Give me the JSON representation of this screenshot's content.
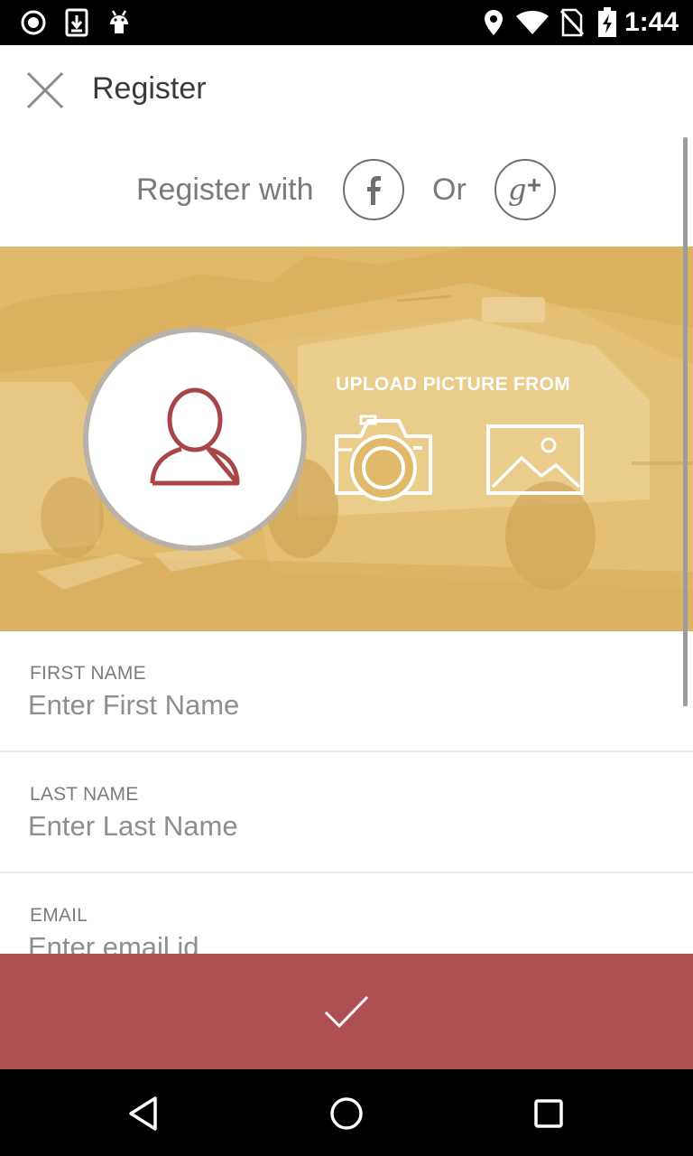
{
  "status_bar": {
    "time": "1:44",
    "left_icons": [
      "record-icon",
      "download-icon",
      "android-icon"
    ],
    "right_icons": [
      "location-icon",
      "wifi-icon",
      "no-sim-icon",
      "battery-charging-icon"
    ]
  },
  "app_bar": {
    "title": "Register",
    "close_icon": "close-icon"
  },
  "social": {
    "prompt": "Register with",
    "or_text": "Or",
    "facebook_icon": "facebook-icon",
    "google_plus_icon": "google-plus-icon"
  },
  "photo": {
    "upload_label": "UPLOAD PICTURE FROM",
    "avatar_icon": "user-icon",
    "camera_icon": "camera-icon",
    "gallery_icon": "gallery-icon",
    "banner_color": "#e1b96a"
  },
  "fields": [
    {
      "label": "FIRST NAME",
      "placeholder": "Enter First Name",
      "value": ""
    },
    {
      "label": "LAST NAME",
      "placeholder": "Enter Last Name",
      "value": ""
    },
    {
      "label": "EMAIL",
      "placeholder": "Enter email id",
      "value": ""
    }
  ],
  "submit": {
    "icon": "check-icon",
    "color": "#ae4f51"
  },
  "nav_bar": {
    "back_icon": "back-icon",
    "home_icon": "home-icon",
    "recents_icon": "recents-icon"
  },
  "colors": {
    "accent": "#ae4f51",
    "avatar_stroke": "#a94547",
    "text_gray": "#7a7a7a"
  }
}
